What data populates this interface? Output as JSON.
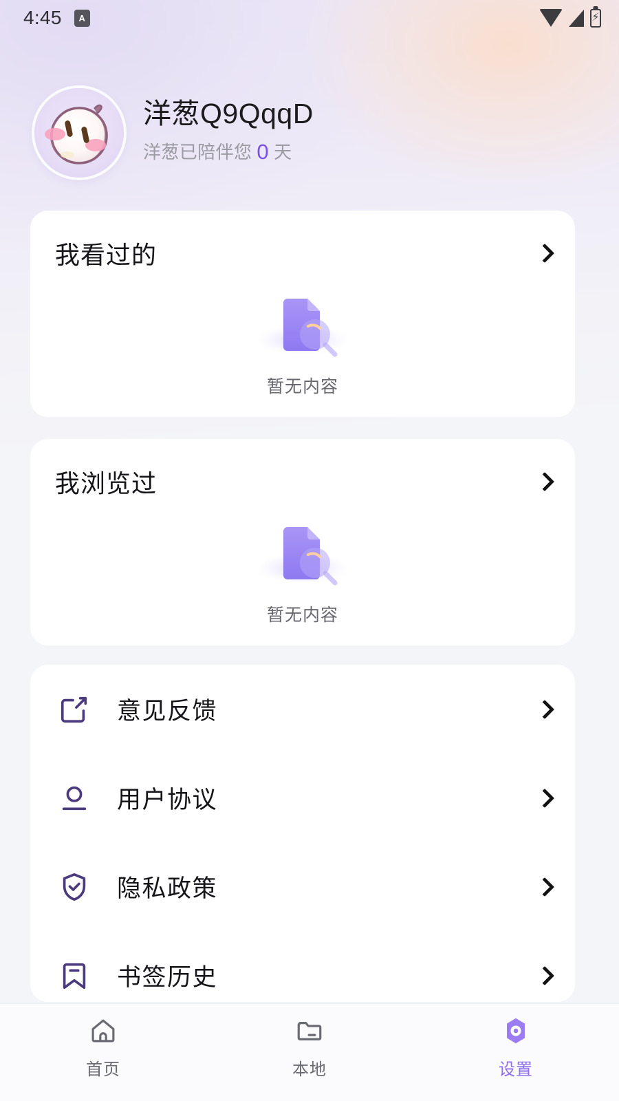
{
  "statusbar": {
    "time": "4:45",
    "app_badge_letter": "A",
    "icons": [
      "wifi-icon",
      "signal-icon",
      "battery-charging-icon"
    ]
  },
  "profile": {
    "avatar": "onion-mascot-avatar",
    "username": "洋葱Q9QqqD",
    "companion_prefix": "洋葱已陪伴您",
    "companion_days": "0",
    "companion_suffix": "天"
  },
  "cards": [
    {
      "title": "我看过的",
      "empty_label": "暂无内容",
      "empty_icon": "document-search-empty-icon",
      "chevron": "chevron-right-icon"
    },
    {
      "title": "我浏览过",
      "empty_label": "暂无内容",
      "empty_icon": "document-search-empty-icon",
      "chevron": "chevron-right-icon"
    }
  ],
  "menu": [
    {
      "label": "意见反馈",
      "icon": "edit-square-icon"
    },
    {
      "label": "用户协议",
      "icon": "user-icon"
    },
    {
      "label": "隐私政策",
      "icon": "shield-check-icon"
    },
    {
      "label": "书签历史",
      "icon": "bookmark-icon"
    }
  ],
  "tabs": [
    {
      "label": "首页",
      "icon": "home-icon",
      "active": false
    },
    {
      "label": "本地",
      "icon": "folder-icon",
      "active": false
    },
    {
      "label": "设置",
      "icon": "settings-hexagon-icon",
      "active": true
    }
  ],
  "colors": {
    "accent_purple": "#8f6ff0",
    "icon_purple": "#4b3a7d",
    "days_purple": "#7b52e8",
    "page_bg": "#f4f5f8",
    "card_bg": "#ffffff",
    "text_primary": "#16161a",
    "text_muted": "#9b9ba3"
  }
}
